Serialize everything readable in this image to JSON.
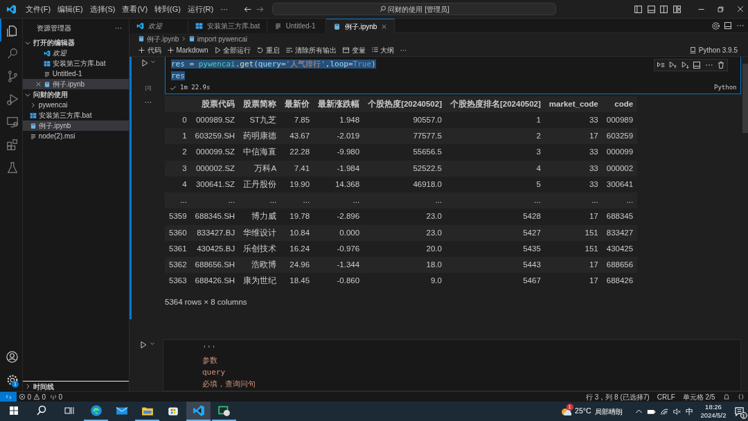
{
  "title_bar": {
    "menus": [
      "文件(F)",
      "编辑(E)",
      "选择(S)",
      "查看(V)",
      "转到(G)",
      "运行(R)",
      "···"
    ],
    "search": "问财的使用 [管理员]"
  },
  "activity_bar": {
    "items": [
      {
        "kind": "explorer",
        "selected": true
      },
      {
        "kind": "search",
        "selected": false
      },
      {
        "kind": "source-control",
        "selected": false
      },
      {
        "kind": "debug",
        "selected": false
      },
      {
        "kind": "remote",
        "selected": false
      },
      {
        "kind": "extensions",
        "selected": false
      },
      {
        "kind": "testing",
        "selected": false
      }
    ],
    "settings_badge": "1"
  },
  "sidebar": {
    "title": "资源管理器",
    "more": "···",
    "sections": [
      {
        "title": "打开的编辑器",
        "expanded": true,
        "items": [
          {
            "label": "欢迎",
            "kind": "welcome",
            "italic": true,
            "selected": false,
            "close": false
          },
          {
            "label": "安装第三方库.bat",
            "kind": "bat",
            "italic": false,
            "selected": false,
            "close": false
          },
          {
            "label": "Untitled-1",
            "kind": "text",
            "italic": false,
            "selected": false,
            "close": false
          },
          {
            "label": "例子.ipynb",
            "kind": "notebook",
            "italic": false,
            "selected": true,
            "close": true
          }
        ]
      },
      {
        "title": "问财的使用",
        "expanded": true,
        "items": [
          {
            "label": "pywencai",
            "kind": "folder",
            "italic": false,
            "selected": false,
            "close": false
          },
          {
            "label": "安装第三方库.bat",
            "kind": "bat",
            "italic": false,
            "selected": false,
            "close": false
          },
          {
            "label": "例子.ipynb",
            "kind": "notebook",
            "italic": false,
            "selected": true,
            "close": false
          },
          {
            "label": "node(2).msi",
            "kind": "text",
            "italic": false,
            "selected": false,
            "close": false
          }
        ]
      }
    ],
    "timeline": {
      "title": "时间线",
      "expanded": false
    }
  },
  "tabs": [
    {
      "label": "欢迎",
      "kind": "welcome",
      "italic": true,
      "selected": false
    },
    {
      "label": "安装第三方库.bat",
      "kind": "bat",
      "italic": false,
      "selected": false
    },
    {
      "label": "Untitled-1",
      "kind": "text",
      "italic": false,
      "selected": false
    },
    {
      "label": "例子.ipynb",
      "kind": "notebook",
      "italic": false,
      "selected": true
    }
  ],
  "breadcrumb": [
    "例子.ipynb",
    "import pywencai"
  ],
  "notebook_toolbar": [
    {
      "label": "代码",
      "kind": "add"
    },
    {
      "label": "Markdown",
      "kind": "add"
    },
    {
      "label": "全部运行",
      "kind": "run-all"
    },
    {
      "label": "重启",
      "kind": "restart"
    },
    {
      "label": "清除所有输出",
      "kind": "clear"
    },
    {
      "label": "变量",
      "kind": "variables"
    },
    {
      "label": "大纲",
      "kind": "outline"
    },
    {
      "label": "···",
      "kind": "more"
    }
  ],
  "kernel": "Python 3.9.5",
  "cell_1": {
    "execution_count": "[3]",
    "duration": "1m 22.9s",
    "language": "Python",
    "succeeded": true,
    "lines": [
      {
        "selected": true,
        "tokens": [
          {
            "text": "res",
            "kind": "variable"
          },
          {
            "text": " = ",
            "kind": "plain"
          },
          {
            "text": "pywencai",
            "kind": "module"
          },
          {
            "text": ".",
            "kind": "plain"
          },
          {
            "text": "get",
            "kind": "function"
          },
          {
            "text": "(",
            "kind": "plain"
          },
          {
            "text": "query",
            "kind": "variable"
          },
          {
            "text": "=",
            "kind": "plain"
          },
          {
            "text": "'人气排行'",
            "kind": "string"
          },
          {
            "text": ",",
            "kind": "plain"
          },
          {
            "text": "loop",
            "kind": "variable"
          },
          {
            "text": "=",
            "kind": "plain"
          },
          {
            "text": "True",
            "kind": "keyword"
          },
          {
            "text": ")",
            "kind": "plain"
          }
        ]
      },
      {
        "selected": true,
        "tokens": [
          {
            "text": "res",
            "kind": "variable"
          }
        ]
      }
    ]
  },
  "output": {
    "marker": "···",
    "columns": [
      "",
      "股票代码",
      "股票简称",
      "最新价",
      "最新涨跌幅",
      "个股热度[20240502]",
      "个股热度排名[20240502]",
      "market_code",
      "code"
    ],
    "rows": [
      [
        "0",
        "000989.SZ",
        "ST九芝",
        "7.85",
        "1.948",
        "90557.0",
        "1",
        "33",
        "000989"
      ],
      [
        "1",
        "603259.SH",
        "药明康德",
        "43.67",
        "-2.019",
        "77577.5",
        "2",
        "17",
        "603259"
      ],
      [
        "2",
        "000099.SZ",
        "中信海直",
        "22.28",
        "-9.980",
        "55656.5",
        "3",
        "33",
        "000099"
      ],
      [
        "3",
        "000002.SZ",
        "万科A",
        "7.41",
        "-1.984",
        "52522.5",
        "4",
        "33",
        "000002"
      ],
      [
        "4",
        "300641.SZ",
        "正丹股份",
        "19.90",
        "14.368",
        "46918.0",
        "5",
        "33",
        "300641"
      ],
      [
        "...",
        "...",
        "...",
        "...",
        "...",
        "...",
        "...",
        "...",
        "..."
      ],
      [
        "5359",
        "688345.SH",
        "博力威",
        "19.78",
        "-2.896",
        "23.0",
        "5428",
        "17",
        "688345"
      ],
      [
        "5360",
        "833427.BJ",
        "华维设计",
        "10.84",
        "0.000",
        "23.0",
        "5427",
        "151",
        "833427"
      ],
      [
        "5361",
        "430425.BJ",
        "乐创技术",
        "16.24",
        "-0.976",
        "20.0",
        "5435",
        "151",
        "430425"
      ],
      [
        "5362",
        "688656.SH",
        "浩欧博",
        "24.96",
        "-1.344",
        "18.0",
        "5443",
        "17",
        "688656"
      ],
      [
        "5363",
        "688426.SH",
        "康为世纪",
        "18.45",
        "-0.860",
        "9.0",
        "5467",
        "17",
        "688426"
      ]
    ],
    "summary": "5364 rows × 8 columns"
  },
  "cell_2": {
    "lines": [
      "'''",
      "参数",
      "query",
      "必填，查询问句"
    ]
  },
  "status_bar": {
    "left": [
      {
        "kind": "error",
        "text": "0"
      },
      {
        "kind": "warning",
        "text": "0"
      },
      {
        "kind": "ports",
        "text": "0"
      }
    ],
    "right": [
      "行 3，列 8 (已选择7)",
      "CRLF",
      "单元格 2/5"
    ]
  },
  "taskbar": {
    "apps": [
      {
        "kind": "edge",
        "running": true,
        "active": false
      },
      {
        "kind": "mail",
        "running": false,
        "active": false
      },
      {
        "kind": "files",
        "running": true,
        "active": false
      },
      {
        "kind": "store",
        "running": false,
        "active": false
      },
      {
        "kind": "vscode",
        "running": true,
        "active": true
      },
      {
        "kind": "chat",
        "running": true,
        "active": false
      }
    ],
    "weather": {
      "temp": "25°C",
      "text": "局部晴朗",
      "badge": "1"
    },
    "ime": "中",
    "time": "18:26",
    "date": "2024/5/2",
    "notifications": "1"
  }
}
